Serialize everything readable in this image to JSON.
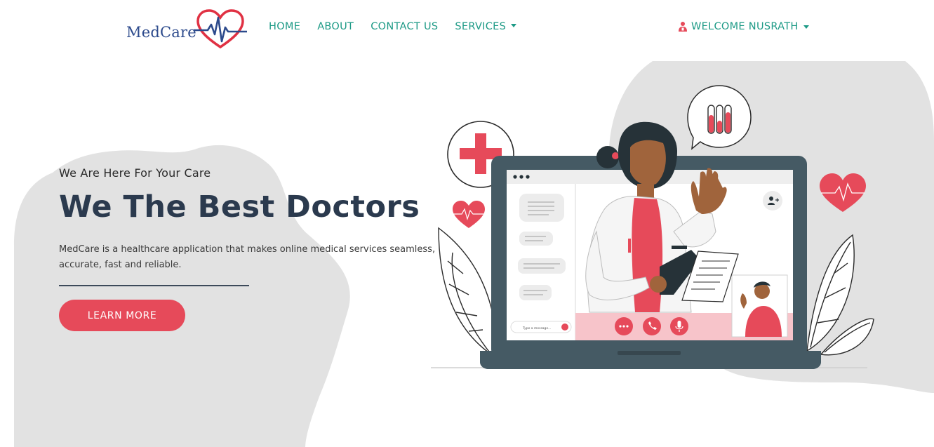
{
  "brand": {
    "name": "MedCare"
  },
  "nav": {
    "links": [
      {
        "label": "HOME"
      },
      {
        "label": "ABOUT"
      },
      {
        "label": "CONTACT US"
      },
      {
        "label": "SERVICES"
      }
    ],
    "user_label": "WELCOME NUSRATH"
  },
  "hero": {
    "tagline": "We Are Here For Your Care",
    "headline": "We The Best Doctors",
    "description": "MedCare is a healthcare application that makes online medical services seamless, accurate, fast and reliable.",
    "cta_label": "LEARN MORE"
  },
  "illustration": {
    "message_placeholder": "Type a message..."
  },
  "colors": {
    "accent": "#e64a5a",
    "nav_text": "#1d9a86",
    "headline": "#2b3a4e",
    "blob": "#e2e2e2",
    "laptop": "#455a64"
  },
  "icons": [
    "heart-pulse-icon",
    "caret-down-icon",
    "user-icon",
    "chat-dots-icon",
    "phone-icon",
    "microphone-icon",
    "add-user-icon",
    "send-icon"
  ]
}
